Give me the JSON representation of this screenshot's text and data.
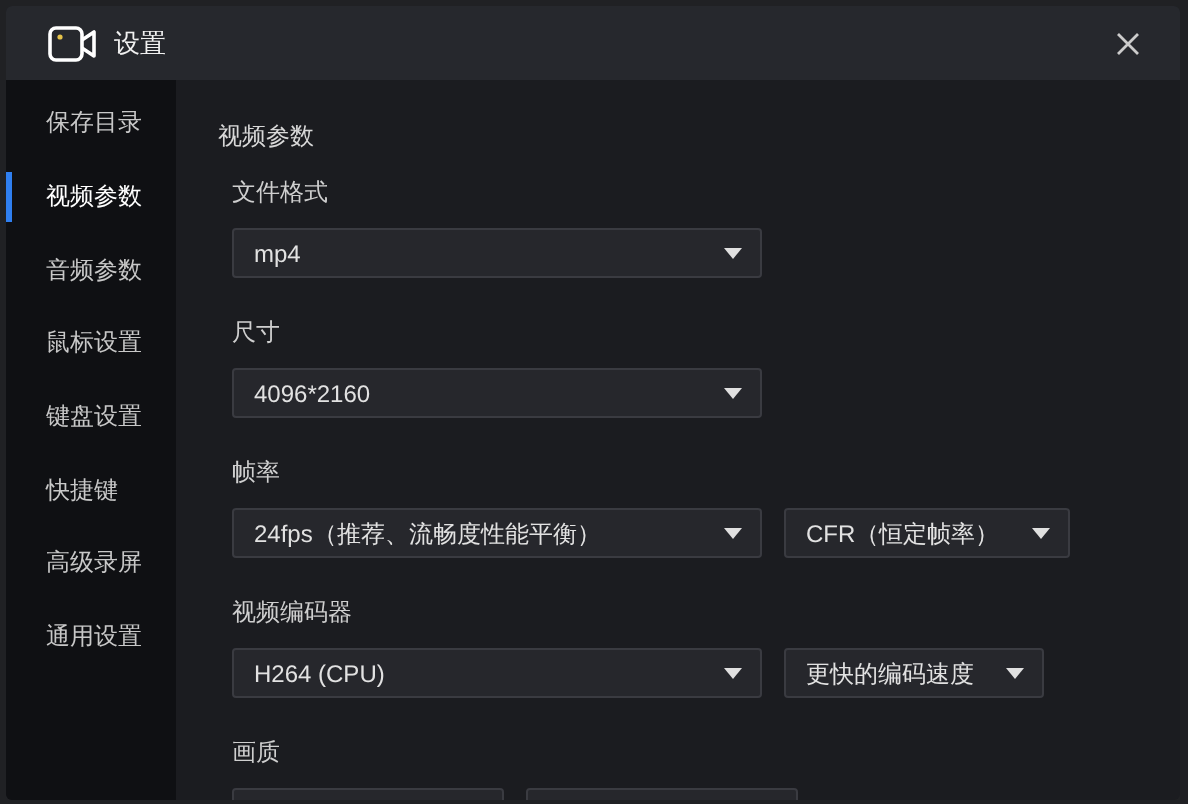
{
  "window": {
    "title": "设置"
  },
  "sidebar": {
    "items": [
      {
        "label": "保存目录",
        "selected": false
      },
      {
        "label": "视频参数",
        "selected": true
      },
      {
        "label": "音频参数",
        "selected": false
      },
      {
        "label": "鼠标设置",
        "selected": false
      },
      {
        "label": "键盘设置",
        "selected": false
      },
      {
        "label": "快捷键",
        "selected": false
      },
      {
        "label": "高级录屏",
        "selected": false
      },
      {
        "label": "通用设置",
        "selected": false
      }
    ]
  },
  "section_title": "视频参数",
  "fields": [
    {
      "label": "文件格式",
      "dropdowns": [
        {
          "value": "mp4"
        }
      ]
    },
    {
      "label": "尺寸",
      "dropdowns": [
        {
          "value": "4096*2160"
        }
      ]
    },
    {
      "label": "帧率",
      "dropdowns": [
        {
          "value": "24fps（推荐、流畅度性能平衡）"
        },
        {
          "value": "CFR（恒定帧率）"
        }
      ]
    },
    {
      "label": "视频编码器",
      "dropdowns": [
        {
          "value": "H264 (CPU)"
        },
        {
          "value": "更快的编码速度"
        }
      ]
    },
    {
      "label": "画质",
      "dropdowns": [
        {
          "kind": "empty"
        },
        {
          "kind": "empty"
        }
      ]
    }
  ]
}
